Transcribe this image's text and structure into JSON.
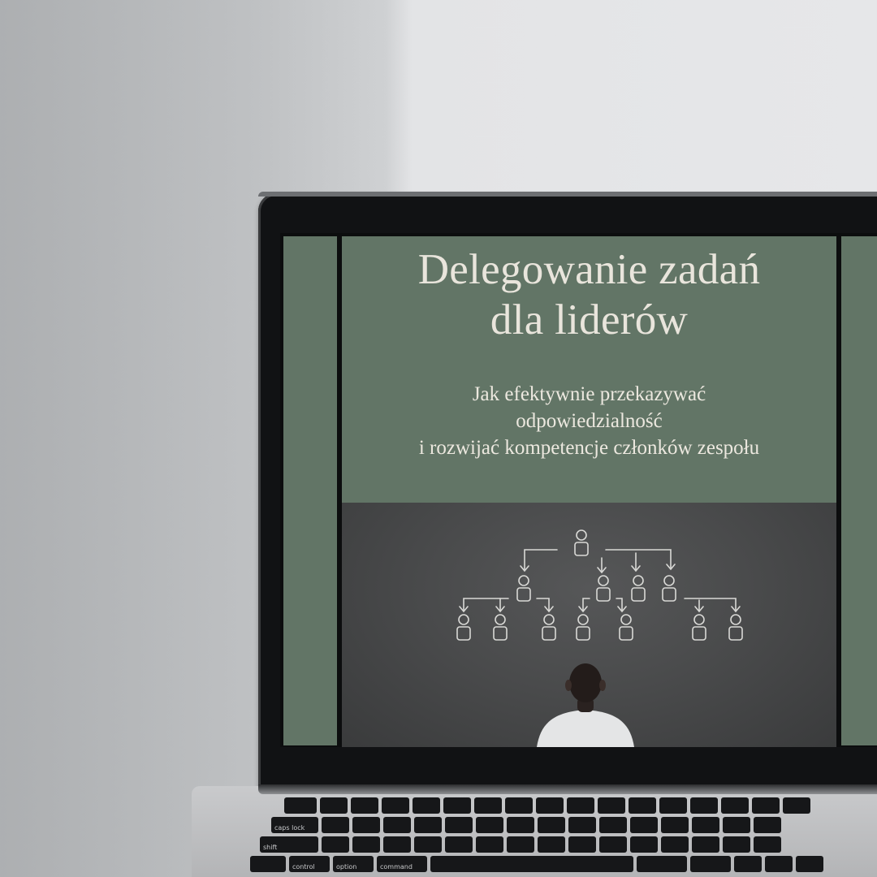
{
  "slide": {
    "title_line1": "Delegowanie zadań",
    "title_line2": "dla liderów",
    "subtitle_line1": "Jak efektywnie przekazywać",
    "subtitle_line2": "odpowiedzialność",
    "subtitle_line3": "i rozwijać kompetencje członków zespołu"
  },
  "keyboard": {
    "caps_lock": "caps lock",
    "shift": "shift",
    "control": "control",
    "option": "option",
    "command": "command"
  },
  "colors": {
    "slide_green": "#627566",
    "title_text": "#e9e5dc",
    "chalkboard": "#4a4b4c"
  }
}
